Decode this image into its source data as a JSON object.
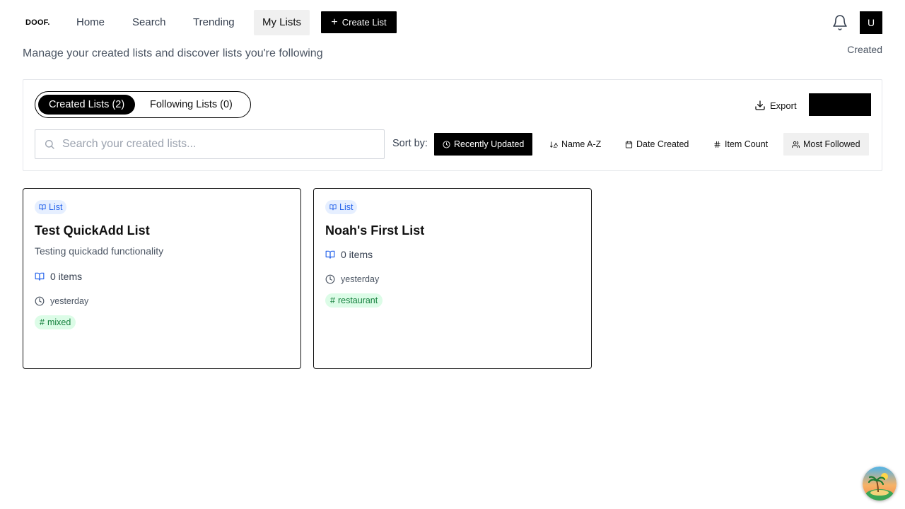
{
  "nav": {
    "logo": "DOOF.",
    "items": [
      {
        "label": "Home"
      },
      {
        "label": "Search"
      },
      {
        "label": "Trending"
      },
      {
        "label": "My Lists"
      }
    ],
    "create_label": "Create List",
    "avatar_initial": "U"
  },
  "header": {
    "subtitle": "Manage your created lists and discover lists you're following",
    "right_label": "Created"
  },
  "panel": {
    "tabs": [
      {
        "label": "Created Lists (2)",
        "active": true
      },
      {
        "label": "Following Lists (0)",
        "active": false
      }
    ],
    "export_label": "Export",
    "search_placeholder": "Search your created lists...",
    "sort_label": "Sort by:",
    "sort_options": [
      {
        "label": "Recently Updated",
        "icon": "clock-icon",
        "active": true
      },
      {
        "label": "Name A-Z",
        "icon": "sort-alpha-icon",
        "active": false
      },
      {
        "label": "Date Created",
        "icon": "calendar-icon",
        "active": false
      },
      {
        "label": "Item Count",
        "icon": "hash-icon",
        "active": false
      },
      {
        "label": "Most Followed",
        "icon": "users-icon",
        "active": false
      }
    ]
  },
  "cards": [
    {
      "badge": "List",
      "title": "Test QuickAdd List",
      "description": "Testing quickadd functionality",
      "items": "0 items",
      "updated": "yesterday",
      "tag": "mixed"
    },
    {
      "badge": "List",
      "title": "Noah's First List",
      "description": "",
      "items": "0 items",
      "updated": "yesterday",
      "tag": "restaurant"
    }
  ],
  "colors": {
    "accent": "#000000",
    "badge_bg": "#e6efff",
    "badge_text": "#2563eb",
    "tag_bg": "#dcfce7",
    "tag_text": "#15803d"
  }
}
